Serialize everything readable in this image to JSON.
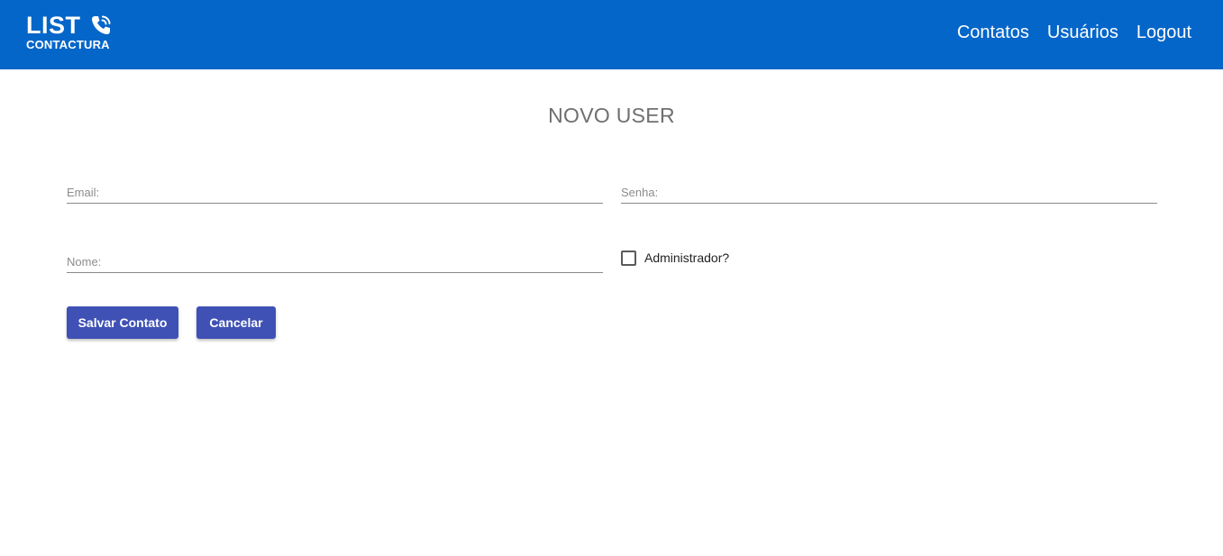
{
  "header": {
    "logo_main": "LIST",
    "logo_sub": "CONTACTURA",
    "nav": [
      {
        "label": "Contatos"
      },
      {
        "label": "Usuários"
      },
      {
        "label": "Logout"
      }
    ],
    "bg_color": "#0566c9"
  },
  "page": {
    "title": "NOVO USER"
  },
  "form": {
    "email_placeholder": "Email:",
    "senha_placeholder": "Senha:",
    "nome_placeholder": "Nome:",
    "admin_label": "Administrador?",
    "admin_checked": false,
    "save_label": "Salvar Contato",
    "cancel_label": "Cancelar",
    "button_color": "#3f51b5"
  }
}
